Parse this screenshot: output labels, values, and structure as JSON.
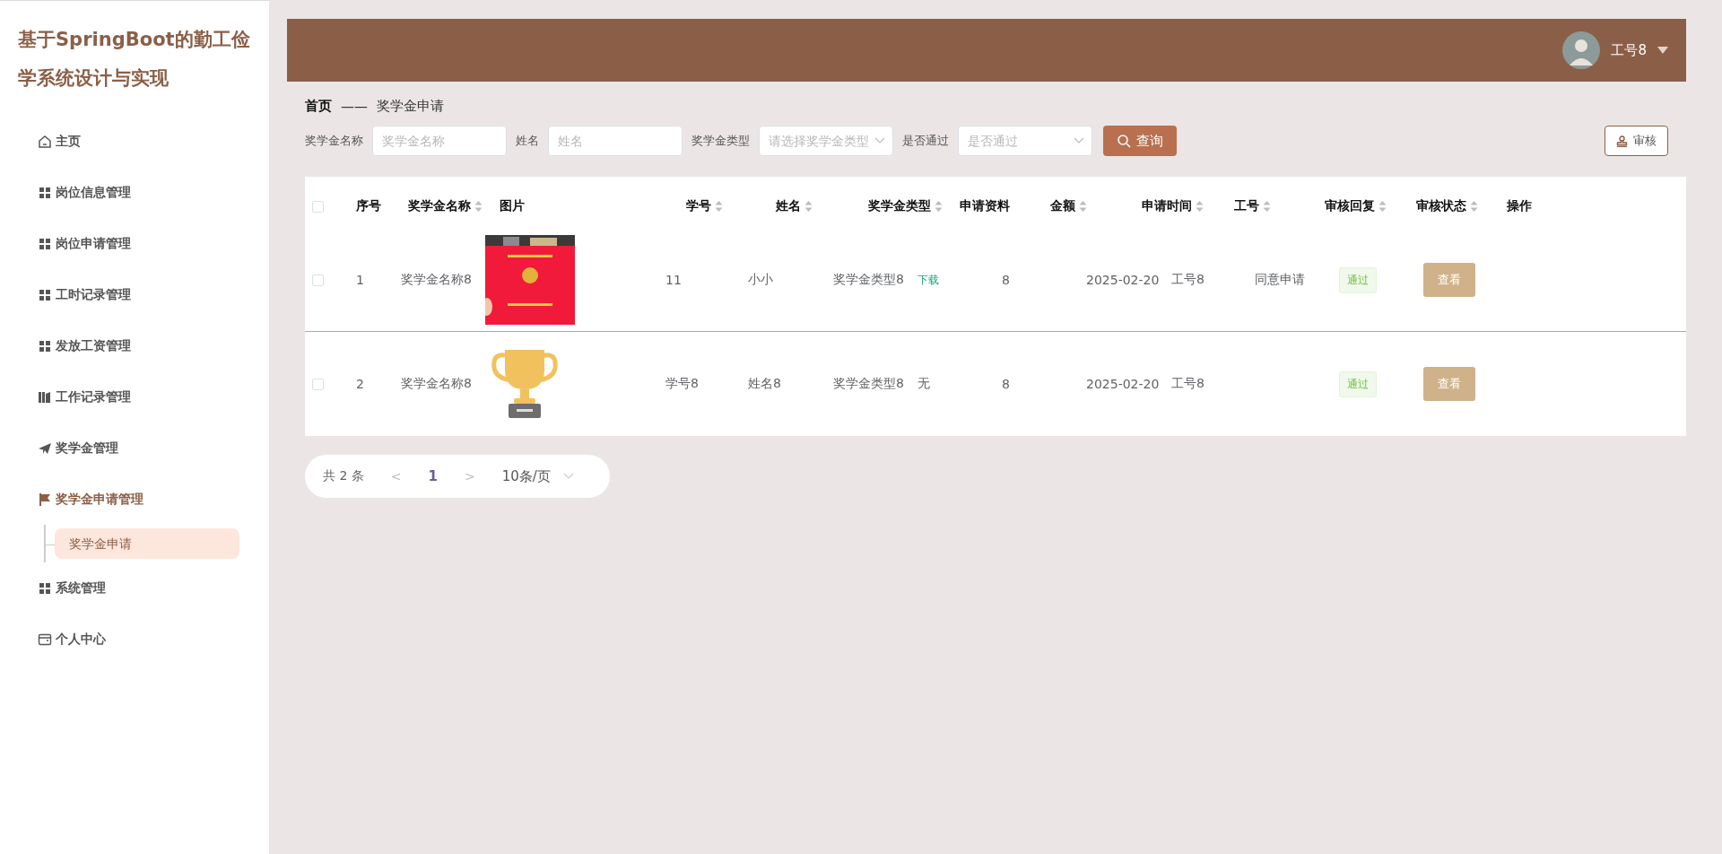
{
  "sidebar": {
    "title": "基于SpringBoot的勤工俭学系统设计与实现",
    "items": [
      {
        "label": "主页",
        "kind": "home",
        "expanded": false
      },
      {
        "label": "岗位信息管理",
        "kind": "grid",
        "expanded": false
      },
      {
        "label": "岗位申请管理",
        "kind": "grid",
        "expanded": false
      },
      {
        "label": "工时记录管理",
        "kind": "grid",
        "expanded": false
      },
      {
        "label": "发放工资管理",
        "kind": "grid",
        "expanded": false
      },
      {
        "label": "工作记录管理",
        "kind": "books",
        "expanded": false
      },
      {
        "label": "奖学金管理",
        "kind": "plane",
        "expanded": false
      },
      {
        "label": "奖学金申请管理",
        "kind": "flag",
        "expanded": true,
        "children": [
          {
            "label": "奖学金申请",
            "selected": true
          }
        ]
      },
      {
        "label": "系统管理",
        "kind": "grid",
        "expanded": false
      },
      {
        "label": "个人中心",
        "kind": "card",
        "expanded": false
      }
    ]
  },
  "header": {
    "user": "工号8"
  },
  "breadcrumb": {
    "home": "首页",
    "separator": "——",
    "current": "奖学金申请"
  },
  "filters": [
    {
      "label": "奖学金名称",
      "placeholder": "奖学金名称",
      "kind": "input"
    },
    {
      "label": "姓名",
      "placeholder": "姓名",
      "kind": "input"
    },
    {
      "label": "奖学金类型",
      "placeholder": "请选择奖学金类型",
      "kind": "select"
    },
    {
      "label": "是否通过",
      "placeholder": "是否通过",
      "kind": "select"
    }
  ],
  "search_button": "查询",
  "review_button": "审核",
  "table": {
    "select_all": false,
    "columns": [
      {
        "label": "序号",
        "sortable": false
      },
      {
        "label": "奖学金名称",
        "sortable": true
      },
      {
        "label": "图片",
        "sortable": false
      },
      {
        "label": "学号",
        "sortable": true
      },
      {
        "label": "姓名",
        "sortable": true
      },
      {
        "label": "奖学金类型",
        "sortable": true
      },
      {
        "label": "申请资料",
        "sortable": false
      },
      {
        "label": "金额",
        "sortable": true
      },
      {
        "label": "申请时间",
        "sortable": true
      },
      {
        "label": "工号",
        "sortable": true
      },
      {
        "label": "审核回复",
        "sortable": true
      },
      {
        "label": "审核状态",
        "sortable": true
      },
      {
        "label": "操作",
        "sortable": false
      }
    ],
    "rows": [
      {
        "checked": false,
        "index": "1",
        "name": "奖学金名称8",
        "student_no": "11",
        "student_name": "小小",
        "type": "奖学金类型8",
        "attachment": {
          "kind": "link",
          "text": "下载"
        },
        "amount": "8",
        "date": "2025-02-20",
        "staff_no": "工号8",
        "reply": "同意申请",
        "status": "通过",
        "action": "查看"
      },
      {
        "checked": false,
        "index": "2",
        "name": "奖学金名称8",
        "image": {
          "kind": "trophy"
        },
        "student_no": "学号8",
        "student_name": "姓名8",
        "type": "奖学金类型8",
        "attachment": {
          "kind": "text",
          "text": "无"
        },
        "amount": "8",
        "date": "2025-02-20",
        "staff_no": "工号8",
        "status": "通过",
        "action": "查看"
      }
    ]
  },
  "pagination": {
    "total": "共 2 条",
    "prev": "<",
    "page": "1",
    "next": ">",
    "page_size": "10条/页"
  }
}
